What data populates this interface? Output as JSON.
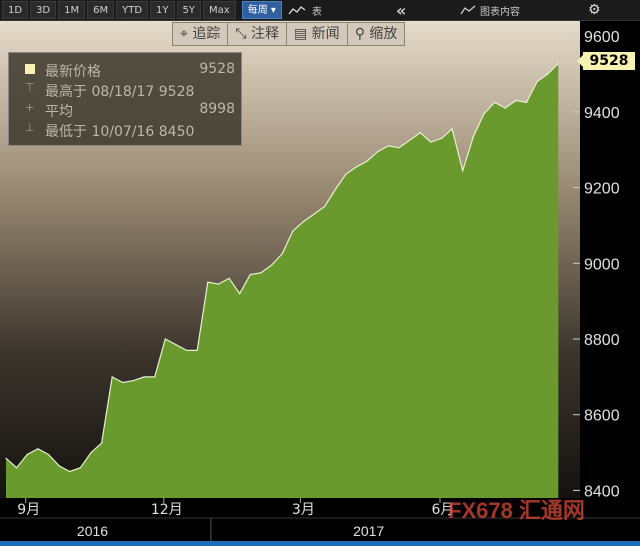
{
  "toolbar": {
    "ranges": [
      "1D",
      "3D",
      "1M",
      "6M",
      "YTD",
      "1Y",
      "5Y",
      "Max"
    ],
    "period_select": "每周 ▾",
    "table_label": "表",
    "collapse_icon": "double-chevron-left-icon",
    "chart_content_label": "图表内容",
    "settings_icon": "gear-icon"
  },
  "chart_actions": [
    {
      "label": "⌖ 追踪",
      "icon": "crosshair-icon"
    },
    {
      "label": "⤡ 注释",
      "icon": "annotate-icon"
    },
    {
      "label": "▤ 新闻",
      "icon": "news-icon"
    },
    {
      "label": "⚲ 缩放",
      "icon": "zoom-icon"
    }
  ],
  "legend": {
    "rows": [
      {
        "label": "最新价格",
        "value": "9528"
      },
      {
        "label": "最高于 08/18/17 9528",
        "value": ""
      },
      {
        "label": "平均",
        "value": "8998"
      },
      {
        "label": "最低于 10/07/16 8450",
        "value": ""
      }
    ]
  },
  "last_price": "9528",
  "watermark": "FX678 汇通网",
  "colors": {
    "area_fill": "#6a9a2e",
    "area_line": "#e8f0d0",
    "price_tag": "#f7f2b0"
  },
  "chart_data": {
    "type": "area",
    "x": [
      "2016-08-19",
      "2016-08-26",
      "2016-09-02",
      "2016-09-09",
      "2016-09-16",
      "2016-09-23",
      "2016-09-30",
      "2016-10-07",
      "2016-10-14",
      "2016-10-21",
      "2016-10-28",
      "2016-11-04",
      "2016-11-11",
      "2016-11-18",
      "2016-11-25",
      "2016-12-02",
      "2016-12-09",
      "2016-12-16",
      "2016-12-23",
      "2016-12-30",
      "2017-01-06",
      "2017-01-13",
      "2017-01-20",
      "2017-01-27",
      "2017-02-03",
      "2017-02-10",
      "2017-02-17",
      "2017-02-24",
      "2017-03-03",
      "2017-03-10",
      "2017-03-17",
      "2017-03-24",
      "2017-03-31",
      "2017-04-07",
      "2017-04-14",
      "2017-04-21",
      "2017-04-28",
      "2017-05-05",
      "2017-05-12",
      "2017-05-19",
      "2017-05-26",
      "2017-06-02",
      "2017-06-09",
      "2017-06-16",
      "2017-06-23",
      "2017-06-30",
      "2017-07-07",
      "2017-07-14",
      "2017-07-21",
      "2017-07-28",
      "2017-08-04",
      "2017-08-11",
      "2017-08-18"
    ],
    "values": [
      8485,
      8460,
      8495,
      8510,
      8495,
      8465,
      8450,
      8460,
      8500,
      8525,
      8700,
      8685,
      8690,
      8700,
      8700,
      8800,
      8785,
      8770,
      8770,
      8950,
      8945,
      8960,
      8920,
      8970,
      8975,
      8995,
      9025,
      9085,
      9110,
      9130,
      9150,
      9195,
      9235,
      9255,
      9270,
      9295,
      9310,
      9305,
      9325,
      9345,
      9320,
      9330,
      9355,
      9245,
      9335,
      9395,
      9425,
      9410,
      9430,
      9425,
      9480,
      9500,
      9528
    ],
    "ylim": [
      8380,
      9640
    ],
    "yticks": [
      8400,
      8600,
      8800,
      9000,
      9200,
      9400,
      9600
    ],
    "xtick_labels": [
      {
        "date": "2016-09-01",
        "label": "9月"
      },
      {
        "date": "2016-12-01",
        "label": "12月"
      },
      {
        "date": "2017-03-01",
        "label": "3月"
      },
      {
        "date": "2017-06-01",
        "label": "6月"
      }
    ],
    "year_labels": [
      {
        "date": "2016-10-15",
        "label": "2016"
      },
      {
        "date": "2017-04-15",
        "label": "2017"
      }
    ],
    "year_boundary": "2017-01-01",
    "x_range": [
      "2016-08-19",
      "2017-08-27"
    ],
    "grid": false,
    "legend": "top-left"
  }
}
